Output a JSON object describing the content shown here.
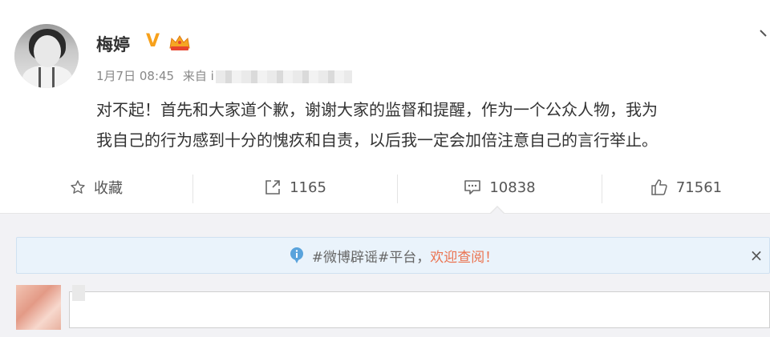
{
  "post": {
    "author": "梅婷",
    "verified_badge": "V",
    "date": "1月7日 08:45",
    "source_prefix": "来自 i",
    "content_line1": "对不起！首先和大家道个歉，谢谢大家的监督和提醒，作为一个公众人物，我为",
    "content_line2": "我自己的行为感到十分的愧疚和自责，以后我一定会加倍注意自己的言行举止。"
  },
  "actions": {
    "favorite_label": "收藏",
    "repost_count": "1165",
    "comment_count": "10838",
    "like_count": "71561"
  },
  "notice": {
    "text": "#微博辟谣#平台，",
    "link": "欢迎查阅！",
    "close": "×"
  },
  "colors": {
    "accent": "#eb7350",
    "verified": "#f7a11b",
    "notice_bg": "#eaf3fb",
    "info_icon": "#59a3dc"
  },
  "icons": [
    "avatar",
    "verified-icon",
    "crown-icon",
    "star-icon",
    "repost-icon",
    "comment-icon",
    "like-icon",
    "info-icon",
    "close-icon"
  ]
}
